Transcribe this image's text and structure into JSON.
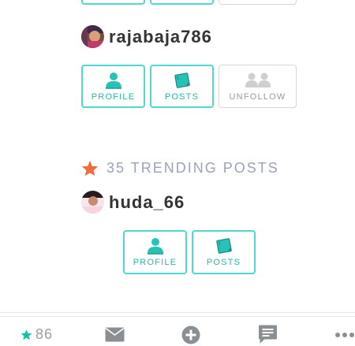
{
  "user1": {
    "username": "rajabaja786",
    "buttons": {
      "profile": "PROFILE",
      "posts": "POSTS",
      "unfollow": "UNFOLLOW"
    }
  },
  "trending": {
    "label": "35 TRENDING POSTS"
  },
  "user2": {
    "username": "huda_66",
    "buttons": {
      "profile": "PROFILE",
      "posts": "POSTS"
    }
  },
  "tabbar": {
    "favorites_count": "86",
    "icons": [
      "star-icon",
      "mail-icon",
      "plus-circle-icon",
      "comment-icon",
      "more-icon"
    ]
  },
  "colors": {
    "accent": "#21b9ad",
    "accent_border": "#4fd8cf",
    "muted": "#9aa3b8",
    "star": "#f26b3a"
  }
}
